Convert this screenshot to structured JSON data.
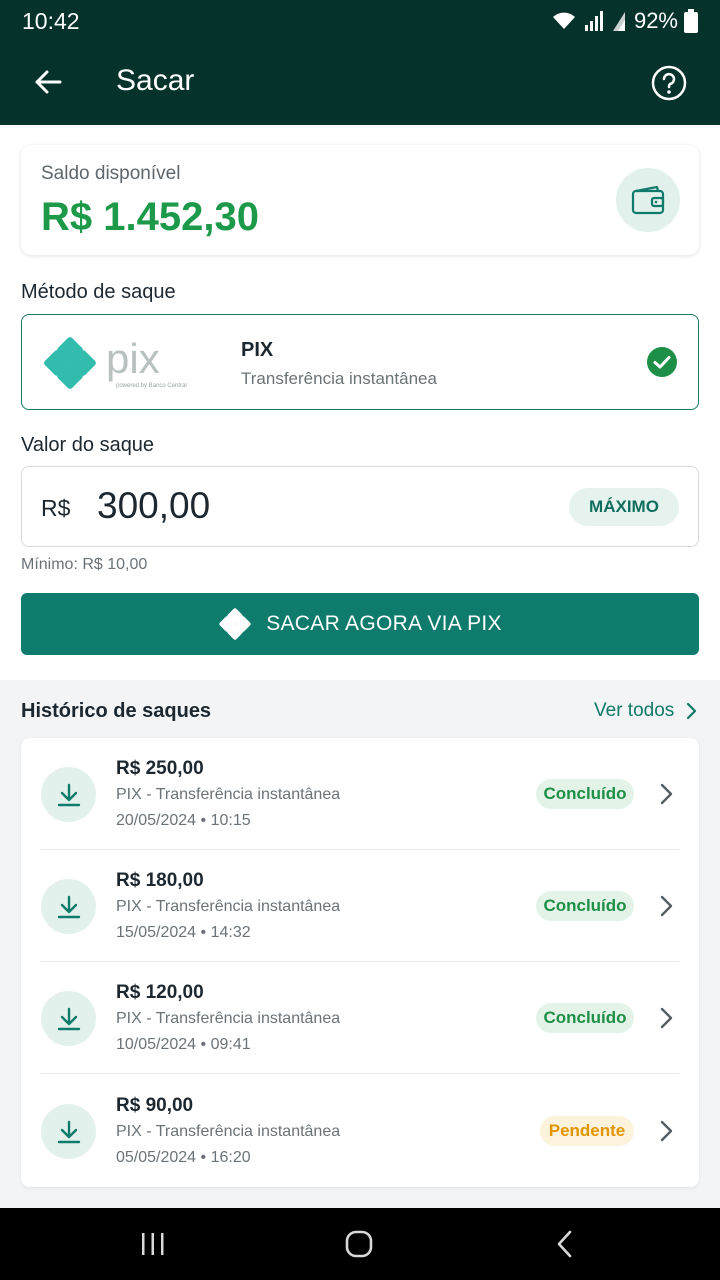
{
  "status": {
    "time": "10:42",
    "battery": "92%"
  },
  "appbar": {
    "title": "Sacar"
  },
  "balance": {
    "label": "Saldo disponível",
    "value": "R$ 1.452,30"
  },
  "method": {
    "section_label": "Método de saque",
    "name": "PIX",
    "subtitle": "Transferência instantânea",
    "logo_text": "pix",
    "logo_tagline": "powered by Banco Central"
  },
  "withdraw": {
    "section_label": "Valor do saque",
    "currency": "R$",
    "value": "300,00",
    "max_label": "MÁXIMO",
    "min_note": "Mínimo: R$ 10,00",
    "cta_label": "SACAR AGORA VIA PIX"
  },
  "history": {
    "title": "Histórico de saques",
    "see_all": "Ver todos",
    "items": [
      {
        "amount": "R$ 250,00",
        "desc": "PIX - Transferência instantânea",
        "date": "20/05/2024 • 10:15",
        "status": "Concluído"
      },
      {
        "amount": "R$ 180,00",
        "desc": "PIX - Transferência instantânea",
        "date": "15/05/2024 • 14:32",
        "status": "Concluído"
      },
      {
        "amount": "R$ 120,00",
        "desc": "PIX - Transferência instantânea",
        "date": "10/05/2024 • 09:41",
        "status": "Concluído"
      },
      {
        "amount": "R$ 90,00",
        "desc": "PIX - Transferência instantânea",
        "date": "05/05/2024 • 16:20",
        "status": "Pendente"
      }
    ]
  },
  "colors": {
    "header": "#06322c",
    "accent": "#0e7b6c",
    "balance_green": "#1c9a4a",
    "status_ok": "#1e8f46",
    "status_pending": "#e39500",
    "pix_teal": "#32bcad"
  }
}
